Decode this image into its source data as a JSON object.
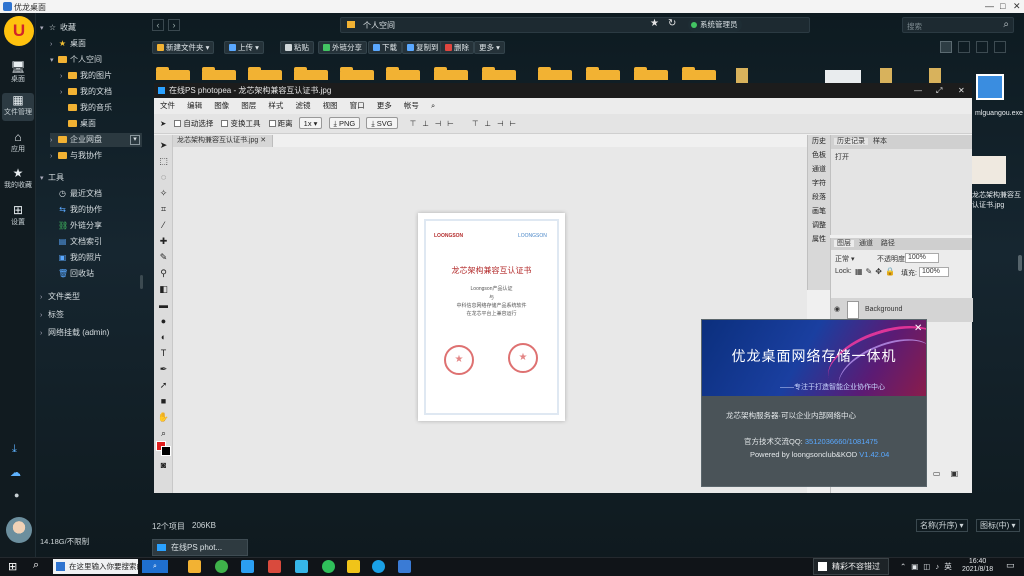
{
  "browser": {
    "title": "优龙桌面"
  },
  "sidebar": {
    "logo": "U",
    "items": [
      {
        "label": "桌面",
        "glyph": "🖥"
      },
      {
        "label": "文件管理",
        "glyph": "▦"
      },
      {
        "label": "应用",
        "glyph": "⌂"
      },
      {
        "label": "我的收藏",
        "glyph": "★"
      },
      {
        "label": "设置",
        "glyph": "⊞"
      }
    ]
  },
  "tree": {
    "items": [
      {
        "label": "收藏",
        "kind": "star-outline",
        "level": 0,
        "expanded": true
      },
      {
        "label": "桌面",
        "kind": "star",
        "level": 1
      },
      {
        "label": "个人空间",
        "kind": "folder",
        "level": 1,
        "expanded": true
      },
      {
        "label": "我的图片",
        "kind": "folder",
        "level": 2
      },
      {
        "label": "我的文档",
        "kind": "folder",
        "level": 2
      },
      {
        "label": "我的音乐",
        "kind": "folder",
        "level": 2
      },
      {
        "label": "桌面",
        "kind": "folder",
        "level": 2
      },
      {
        "label": "企业网盘",
        "kind": "folder",
        "level": 1
      },
      {
        "label": "与我协作",
        "kind": "folder",
        "level": 1
      },
      {
        "label": "工具",
        "kind": "none",
        "level": 0,
        "expanded": true
      },
      {
        "label": "最近文档",
        "kind": "clock",
        "level": 1
      },
      {
        "label": "我的协作",
        "kind": "share",
        "level": 1
      },
      {
        "label": "外链分享",
        "kind": "link",
        "level": 1
      },
      {
        "label": "文档索引",
        "kind": "doc",
        "level": 1
      },
      {
        "label": "我的照片",
        "kind": "photo",
        "level": 1
      },
      {
        "label": "回收站",
        "kind": "trash",
        "level": 1
      },
      {
        "label": "文件类型",
        "kind": "none",
        "level": 0
      },
      {
        "label": "标签",
        "kind": "none",
        "level": 0
      },
      {
        "label": "网络挂载 (admin)",
        "kind": "none",
        "level": 0
      }
    ],
    "status": "14.18G/不限制"
  },
  "header": {
    "address": "个人空间",
    "online_label": "系统管理员",
    "search_placeholder": "搜索"
  },
  "toolbar": {
    "new_folder": "新建文件夹",
    "upload": "上传",
    "paste": "粘贴",
    "share": "外链分享",
    "download": "下载",
    "copy": "复制到",
    "delete": "删除",
    "more": "更多"
  },
  "photoshop": {
    "title": "在线PS photopea - 龙芯架构兼容互认证书.jpg",
    "menu": [
      "文件",
      "编辑",
      "图像",
      "图层",
      "样式",
      "滤镜",
      "视图",
      "窗口",
      "更多",
      "帐号"
    ],
    "options": {
      "auto_select": "自动选择",
      "transform": "变换工具",
      "distance": "距离",
      "zoom": "1x",
      "png": "PNG",
      "svg": "SVG"
    },
    "doc_tab": "龙芯架构兼容互认证书.jpg",
    "right_strip": [
      "历史",
      "色板",
      "通道",
      "字符",
      "段落",
      "画笔",
      "调整",
      "属性"
    ],
    "history": {
      "tab1": "历史记录",
      "tab2": "样本",
      "entry": "打开"
    },
    "layers": {
      "tab1": "图层",
      "tab2": "通道",
      "tab3": "路径",
      "blend": "正常",
      "opacity_label": "不透明度:",
      "opacity": "100%",
      "lock_label": "Lock:",
      "fill_label": "填充:",
      "fill": "100%",
      "layer_name": "Background"
    },
    "certificate": {
      "brand_left": "LOONGSON",
      "brand_right": "LOONGSON",
      "title": "龙芯架构兼容互认证书",
      "lines": [
        "Loongson产品认证",
        "与",
        "中科信息网络存储产品系统软件",
        "在龙芯平台上兼容运行"
      ]
    }
  },
  "popup": {
    "title": "优龙桌面网络存储一体机",
    "subtitle": "——专注于打造智能企业协作中心",
    "line1": "龙芯架构服务器·可以企业内部网络中心",
    "line2_label": "官方技术交流QQ:",
    "line2_value": "3512036660/1081475",
    "line3_label": "Powered by loongsonclub&KOD",
    "line3_value": "V1.42.04"
  },
  "status": {
    "count": "12个项目",
    "size": "206KB",
    "sort": "名称(升序)",
    "view": "图标(中)"
  },
  "minimized_tab": {
    "label": "在线PS phot..."
  },
  "taskbar": {
    "search_text": "在这里输入你要搜索的内容",
    "ime": "精彩不容错过",
    "time": "16:40",
    "date": "2021/8/18"
  }
}
